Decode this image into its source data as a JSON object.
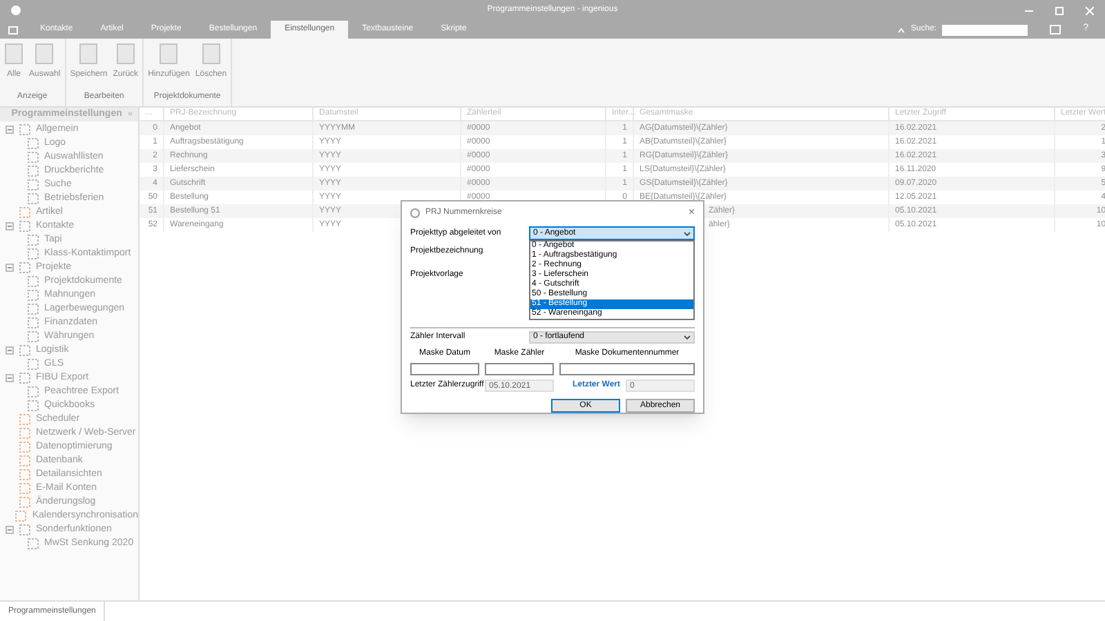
{
  "window": {
    "title": "Programmeinstellungen - ingenious"
  },
  "menu_tabs": [
    {
      "label": "Kontakte",
      "selected": false
    },
    {
      "label": "Artikel",
      "selected": false
    },
    {
      "label": "Projekte",
      "selected": false
    },
    {
      "label": "Bestellungen",
      "selected": false
    },
    {
      "label": "Einstellungen",
      "selected": true
    },
    {
      "label": "Textbausteine",
      "selected": false
    },
    {
      "label": "Skripte",
      "selected": false
    }
  ],
  "search": {
    "label": "Suche:"
  },
  "help": "?",
  "ribbon": [
    {
      "label": "Anzeige",
      "buttons": [
        "Alle",
        "Auswahl"
      ]
    },
    {
      "label": "Bearbeiten",
      "buttons": [
        "Speichern",
        "Zurück"
      ]
    },
    {
      "label": "Projektdokumente",
      "buttons": [
        "Hinzufügen",
        "Löschen"
      ]
    }
  ],
  "sidebar": {
    "title": "Programmeinstellungen",
    "collapse": "«",
    "items": [
      {
        "label": "Allgemein",
        "expanded": true,
        "children": [
          {
            "label": "Logo"
          },
          {
            "label": "Auswahllisten"
          },
          {
            "label": "Druckberichte"
          },
          {
            "label": "Suche"
          },
          {
            "label": "Betriebsferien"
          }
        ]
      },
      {
        "label": "Artikel"
      },
      {
        "label": "Kontakte",
        "expanded": true,
        "children": [
          {
            "label": "Tapi"
          },
          {
            "label": "Klass-Kontaktimport"
          }
        ]
      },
      {
        "label": "Projekte",
        "expanded": true,
        "children": [
          {
            "label": "Projektdokumente"
          },
          {
            "label": "Mahnungen"
          },
          {
            "label": "Lagerbewegungen"
          },
          {
            "label": "Finanzdaten"
          },
          {
            "label": "Währungen"
          }
        ]
      },
      {
        "label": "Logistik",
        "expanded": true,
        "children": [
          {
            "label": "GLS"
          }
        ]
      },
      {
        "label": "FIBU Export",
        "expanded": true,
        "children": [
          {
            "label": "Peachtree Export"
          },
          {
            "label": "Quickbooks"
          }
        ]
      },
      {
        "label": "Scheduler"
      },
      {
        "label": "Netzwerk / Web-Server"
      },
      {
        "label": "Datenoptimierung"
      },
      {
        "label": "Datenbank"
      },
      {
        "label": "Detailansichten"
      },
      {
        "label": "E-Mail Konten"
      },
      {
        "label": "Änderungslog"
      },
      {
        "label": "Kalendersynchronisation"
      },
      {
        "label": "Sonderfunktionen",
        "expanded": true,
        "children": [
          {
            "label": "MwSt Senkung 2020"
          }
        ]
      }
    ]
  },
  "table": {
    "columns": [
      "...",
      "PRJ-Bezeichnung",
      "Datumsteil",
      "Zählerteil",
      "Inter...",
      "Gesamtmaske",
      "Letzter Zugriff",
      "Letzter Wert"
    ],
    "rows": [
      [
        "0",
        "Angebot",
        "YYYYMM",
        "#0000",
        "1",
        "AG{Datumsteil}\\{Zähler}",
        "16.02.2021",
        "2"
      ],
      [
        "1",
        "Auftragsbestätigung",
        "YYYY",
        "#0000",
        "1",
        "AB{Datumsteil}\\{Zähler}",
        "16.02.2021",
        "1"
      ],
      [
        "2",
        "Rechnung",
        "YYYY",
        "#0000",
        "1",
        "RG{Datumsteil}\\{Zähler}",
        "16.02.2021",
        "3"
      ],
      [
        "3",
        "Lieferschein",
        "YYYY",
        "#0000",
        "1",
        "LS{Datumsteil}\\{Zähler}",
        "16.11.2020",
        "9"
      ],
      [
        "4",
        "Gutschrift",
        "YYYY",
        "#0000",
        "1",
        "GS{Datumsteil}\\{Zähler}",
        "09.07.2020",
        "5"
      ],
      [
        "50",
        "Bestellung",
        "YYYY",
        "#0000",
        "0",
        "BE{Datumsteil}\\{Zähler}",
        "12.05.2021",
        "4"
      ],
      [
        "51",
        "Bestellung 51",
        "YYYY",
        "",
        "",
        "Zähler}",
        "05.10.2021",
        "10"
      ],
      [
        "52",
        "Wareneingang",
        "YYYY",
        "",
        "",
        "ähler}",
        "05.10.2021",
        "10"
      ]
    ]
  },
  "bottom_tab": "Programmeinstellungen",
  "dialog": {
    "title": "PRJ Nummernkreise",
    "close": "×",
    "projekttyp_label": "Projekttyp abgeleitet von",
    "projekttyp_value": "0 - Angebot",
    "options": [
      {
        "label": "0 - Angebot",
        "selected": false
      },
      {
        "label": "1 - Auftragsbestätigung",
        "selected": false
      },
      {
        "label": "2 - Rechnung",
        "selected": false
      },
      {
        "label": "3 - Lieferschein",
        "selected": false
      },
      {
        "label": "4 - Gutschrift",
        "selected": false
      },
      {
        "label": "50 - Bestellung",
        "selected": false
      },
      {
        "label": "51 - Bestellung",
        "selected": true
      },
      {
        "label": "52 - Wareneingang",
        "selected": false
      }
    ],
    "projektbezeichnung_label": "Projektbezeichnung",
    "projektvorlage_label": "Projektvorlage",
    "intervall_label": "Zähler Intervall",
    "intervall_value": "0 - fortlaufend",
    "mask_labels": [
      "Maske Datum",
      "Maske Zähler",
      "Maske Dokumentennummer"
    ],
    "letzter_zugriff_label": "Letzter Zählerzugriff",
    "letzter_zugriff_value": "05.10.2021",
    "letzter_wert_label": "Letzter Wert",
    "letzter_wert_value": "0",
    "ok": "OK",
    "cancel": "Abbrechen"
  }
}
